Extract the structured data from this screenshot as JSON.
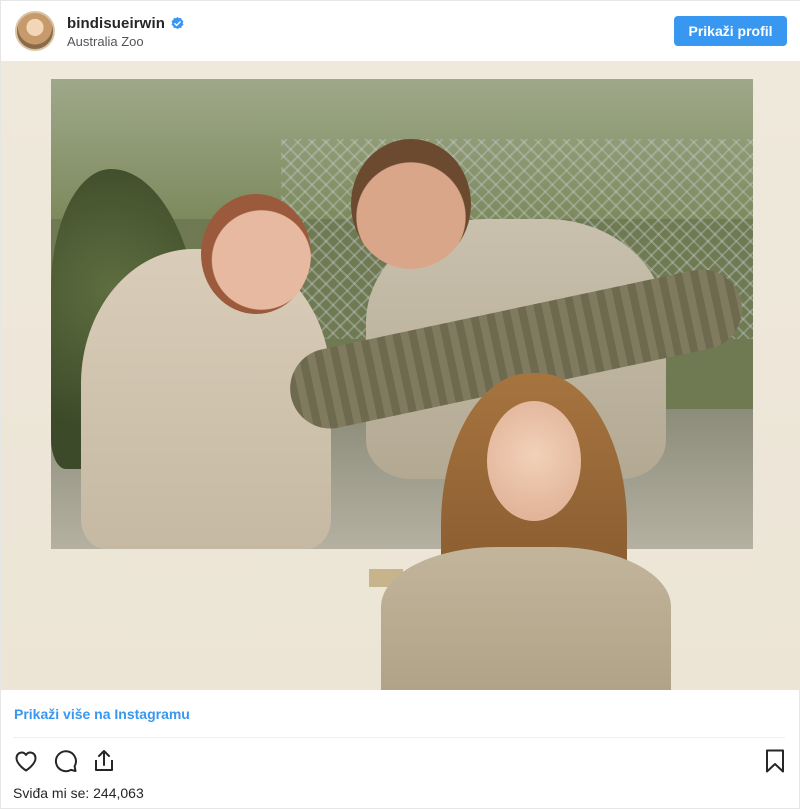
{
  "header": {
    "username": "bindisueirwin",
    "location": "Australia Zoo",
    "profile_button_label": "Prikaži profil"
  },
  "post": {
    "more_link": "Prikaži više na Instagramu",
    "likes_label": "Sviđa mi se: 244,063"
  },
  "icons": {
    "avatar": "profile-avatar",
    "verified": "verified-badge-icon",
    "like": "heart-icon",
    "comment": "comment-icon",
    "share": "share-icon",
    "save": "bookmark-icon"
  },
  "colors": {
    "accent": "#3897f0",
    "text": "#262626",
    "muted": "#555555"
  }
}
